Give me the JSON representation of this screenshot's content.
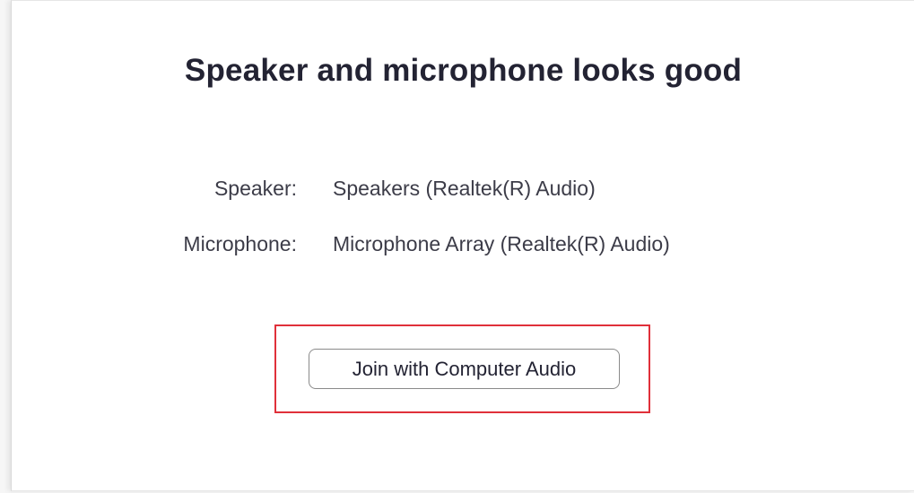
{
  "dialog": {
    "title": "Speaker and microphone looks good",
    "devices": [
      {
        "label": "Speaker:",
        "value": "Speakers (Realtek(R) Audio)"
      },
      {
        "label": "Microphone:",
        "value": "Microphone Array (Realtek(R) Audio)"
      }
    ],
    "join_button_label": "Join with Computer Audio"
  },
  "colors": {
    "title_text": "#232333",
    "body_text": "#3c3c48",
    "highlight_border": "#e0303a",
    "button_border": "#8a8a8a"
  }
}
